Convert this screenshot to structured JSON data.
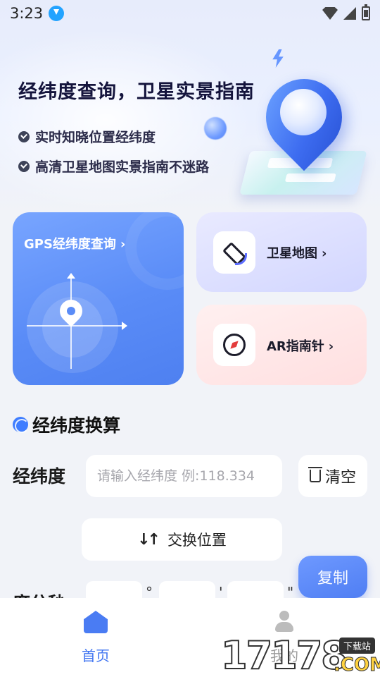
{
  "status_bar": {
    "time": "3:23",
    "icons": [
      "download-icon",
      "wifi-icon",
      "signal-icon",
      "battery-icon"
    ]
  },
  "hero": {
    "title": "经纬度查询，卫星实景指南",
    "features": [
      "实时知晓位置经纬度",
      "高清卫星地图实景指南不迷路"
    ]
  },
  "cards": {
    "gps": {
      "label": "GPS经纬度查询",
      "chevron": "›"
    },
    "satellite": {
      "label": "卫星地图",
      "chevron": "›",
      "icon": "satellite-icon"
    },
    "ar": {
      "label": "AR指南针",
      "chevron": "›",
      "icon": "compass-icon"
    }
  },
  "converter": {
    "section_title": "经纬度换算",
    "lnglat_label": "经纬度",
    "lnglat_placeholder": "请输入经纬度 例:118.334",
    "clear_label": "清空",
    "swap_label": "交换位置",
    "copy_label": "复制",
    "dms_label": "度分秒",
    "dms_marks": [
      "°",
      "'",
      "\""
    ]
  },
  "tabbar": {
    "items": [
      {
        "label": "首页",
        "icon": "home-icon",
        "active": true
      },
      {
        "label": "我的",
        "icon": "user-icon",
        "active": false
      }
    ]
  },
  "watermark": {
    "digits": "17178",
    "tag": "下载站",
    "suffix": ".COM"
  },
  "colors": {
    "accent": "#4f7ef3",
    "card_sat_bg": "#d2d6ff",
    "card_ar_bg": "#ffdfe0",
    "compass_needle": "#e33c3c"
  }
}
